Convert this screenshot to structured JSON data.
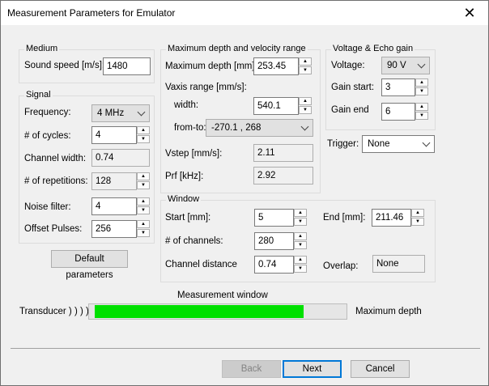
{
  "window": {
    "title": "Measurement Parameters for Emulator",
    "close_glyph": "✕"
  },
  "medium": {
    "title": "Medium",
    "sound_speed_label": "Sound speed [m/s]:",
    "sound_speed": "1480"
  },
  "signal": {
    "title": "Signal",
    "frequency_label": "Frequency:",
    "frequency": "4 MHz",
    "cycles_label": "# of cycles:",
    "cycles": "4",
    "channel_width_label": "Channel width:",
    "channel_width": "0.74",
    "repetitions_label": "# of repetitions:",
    "repetitions": "128",
    "noise_filter_label": "Noise filter:",
    "noise_filter": "4",
    "offset_pulses_label": "Offset Pulses:",
    "offset_pulses": "256"
  },
  "default_button": "Default parameters",
  "depth": {
    "title": "Maximum depth and velocity range",
    "max_depth_label": "Maximum depth [mm]:",
    "max_depth": "253.45",
    "vaxis_label": "Vaxis range [mm/s]:",
    "width_label": "width:",
    "width": "540.1",
    "fromto_label": "from-to:",
    "fromto": "-270.1 , 268",
    "vstep_label": "Vstep [mm/s]:",
    "vstep": "2.11",
    "prf_label": "Prf [kHz]:",
    "prf": "2.92"
  },
  "voltage": {
    "title": "Voltage & Echo gain",
    "voltage_label": "Voltage:",
    "voltage": "90 V",
    "gain_start_label": "Gain start:",
    "gain_start": "3",
    "gain_end_label": "Gain end",
    "gain_end": "6"
  },
  "trigger": {
    "label": "Trigger:",
    "value": "None"
  },
  "window_group": {
    "title": "Window",
    "start_label": "Start [mm]:",
    "start": "5",
    "end_label": "End [mm]:",
    "end": "211.46",
    "channels_label": "# of channels:",
    "channels": "280",
    "channel_distance_label": "Channel distance",
    "channel_distance": "0.74",
    "overlap_label": "Overlap:",
    "overlap": "None"
  },
  "measurement": {
    "title": "Measurement window",
    "transducer_label": "Transducer ) ) ) )",
    "max_depth_label": "Maximum depth",
    "fill_fraction": 0.83,
    "fill_color": "#00e000"
  },
  "buttons": {
    "back": "Back",
    "next": "Next",
    "cancel": "Cancel"
  }
}
